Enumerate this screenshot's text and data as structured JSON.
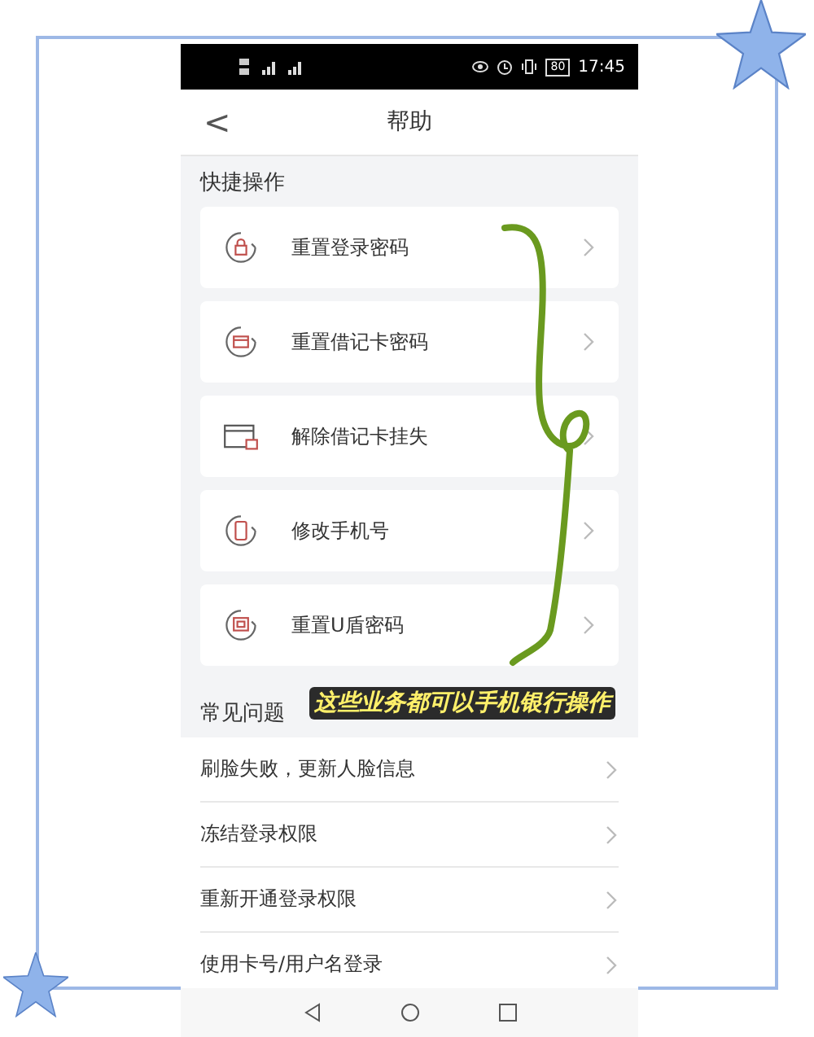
{
  "status_bar": {
    "time": "17:45",
    "battery": "80"
  },
  "header": {
    "back": "<",
    "title": "帮助"
  },
  "quick_actions": {
    "title": "快捷操作",
    "items": [
      {
        "label": "重置登录密码",
        "kind": "lock"
      },
      {
        "label": "重置借记卡密码",
        "kind": "card"
      },
      {
        "label": "解除借记卡挂失",
        "kind": "card-lock"
      },
      {
        "label": "修改手机号",
        "kind": "phone"
      },
      {
        "label": "重置U盾密码",
        "kind": "ukey"
      }
    ]
  },
  "faq": {
    "title": "常见问题",
    "items": [
      {
        "label": "刷脸失败，更新人脸信息"
      },
      {
        "label": "冻结登录权限"
      },
      {
        "label": "重新开通登录权限"
      },
      {
        "label": "使用卡号/用户名登录"
      }
    ]
  },
  "caption": "这些业务都可以手机银行操作"
}
